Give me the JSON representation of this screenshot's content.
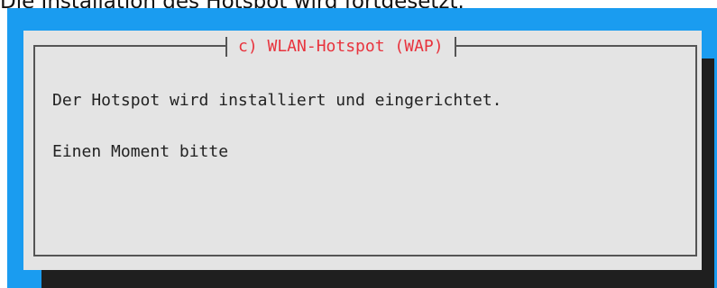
{
  "page": {
    "caption": "Die Installation des Hotspot wird fortgesetzt."
  },
  "dialog": {
    "title": "c) WLAN-Hotspot (WAP)",
    "message_line_1": "Der Hotspot wird installiert und eingerichtet.",
    "message_line_2": "Einen Moment bitte"
  },
  "colors": {
    "terminal_background": "#1a9cf0",
    "dialog_background": "#e4e4e4",
    "shadow": "#1f1f1f",
    "title_text": "#e8333d",
    "body_text": "#222222",
    "frame_border": "#555555"
  }
}
